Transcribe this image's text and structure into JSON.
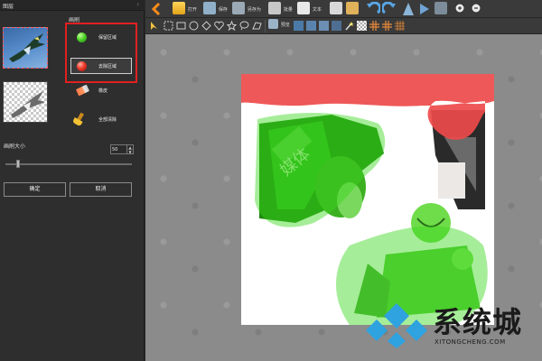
{
  "panel": {
    "title": "图层",
    "brush_heading": "画刷",
    "brush_options": [
      {
        "label": "保留区域",
        "icon": "green-dot-icon"
      },
      {
        "label": "去除区域",
        "icon": "red-dot-icon",
        "selected": true
      },
      {
        "label": "橡皮",
        "icon": "eraser-icon"
      },
      {
        "label": "全部清除",
        "icon": "broom-icon"
      }
    ],
    "brush_size_label": "画刷大小",
    "brush_size_value": "50",
    "brush_size_fraction": 0.1,
    "ok_label": "确定",
    "cancel_label": "取消"
  },
  "toolbar": {
    "open_label": "打开",
    "save_label": "保存",
    "save_as_label": "另存为",
    "batch_label": "批量",
    "text_label": "文本"
  },
  "toolbar2": {
    "preview_label": "预览"
  },
  "watermark": {
    "text": "系统城",
    "subtext": "XITONGCHENG.COM"
  },
  "colors": {
    "keep_green": "#3ad61c",
    "remove_red": "#ee3a2a",
    "highlight_red": "#e02020"
  }
}
